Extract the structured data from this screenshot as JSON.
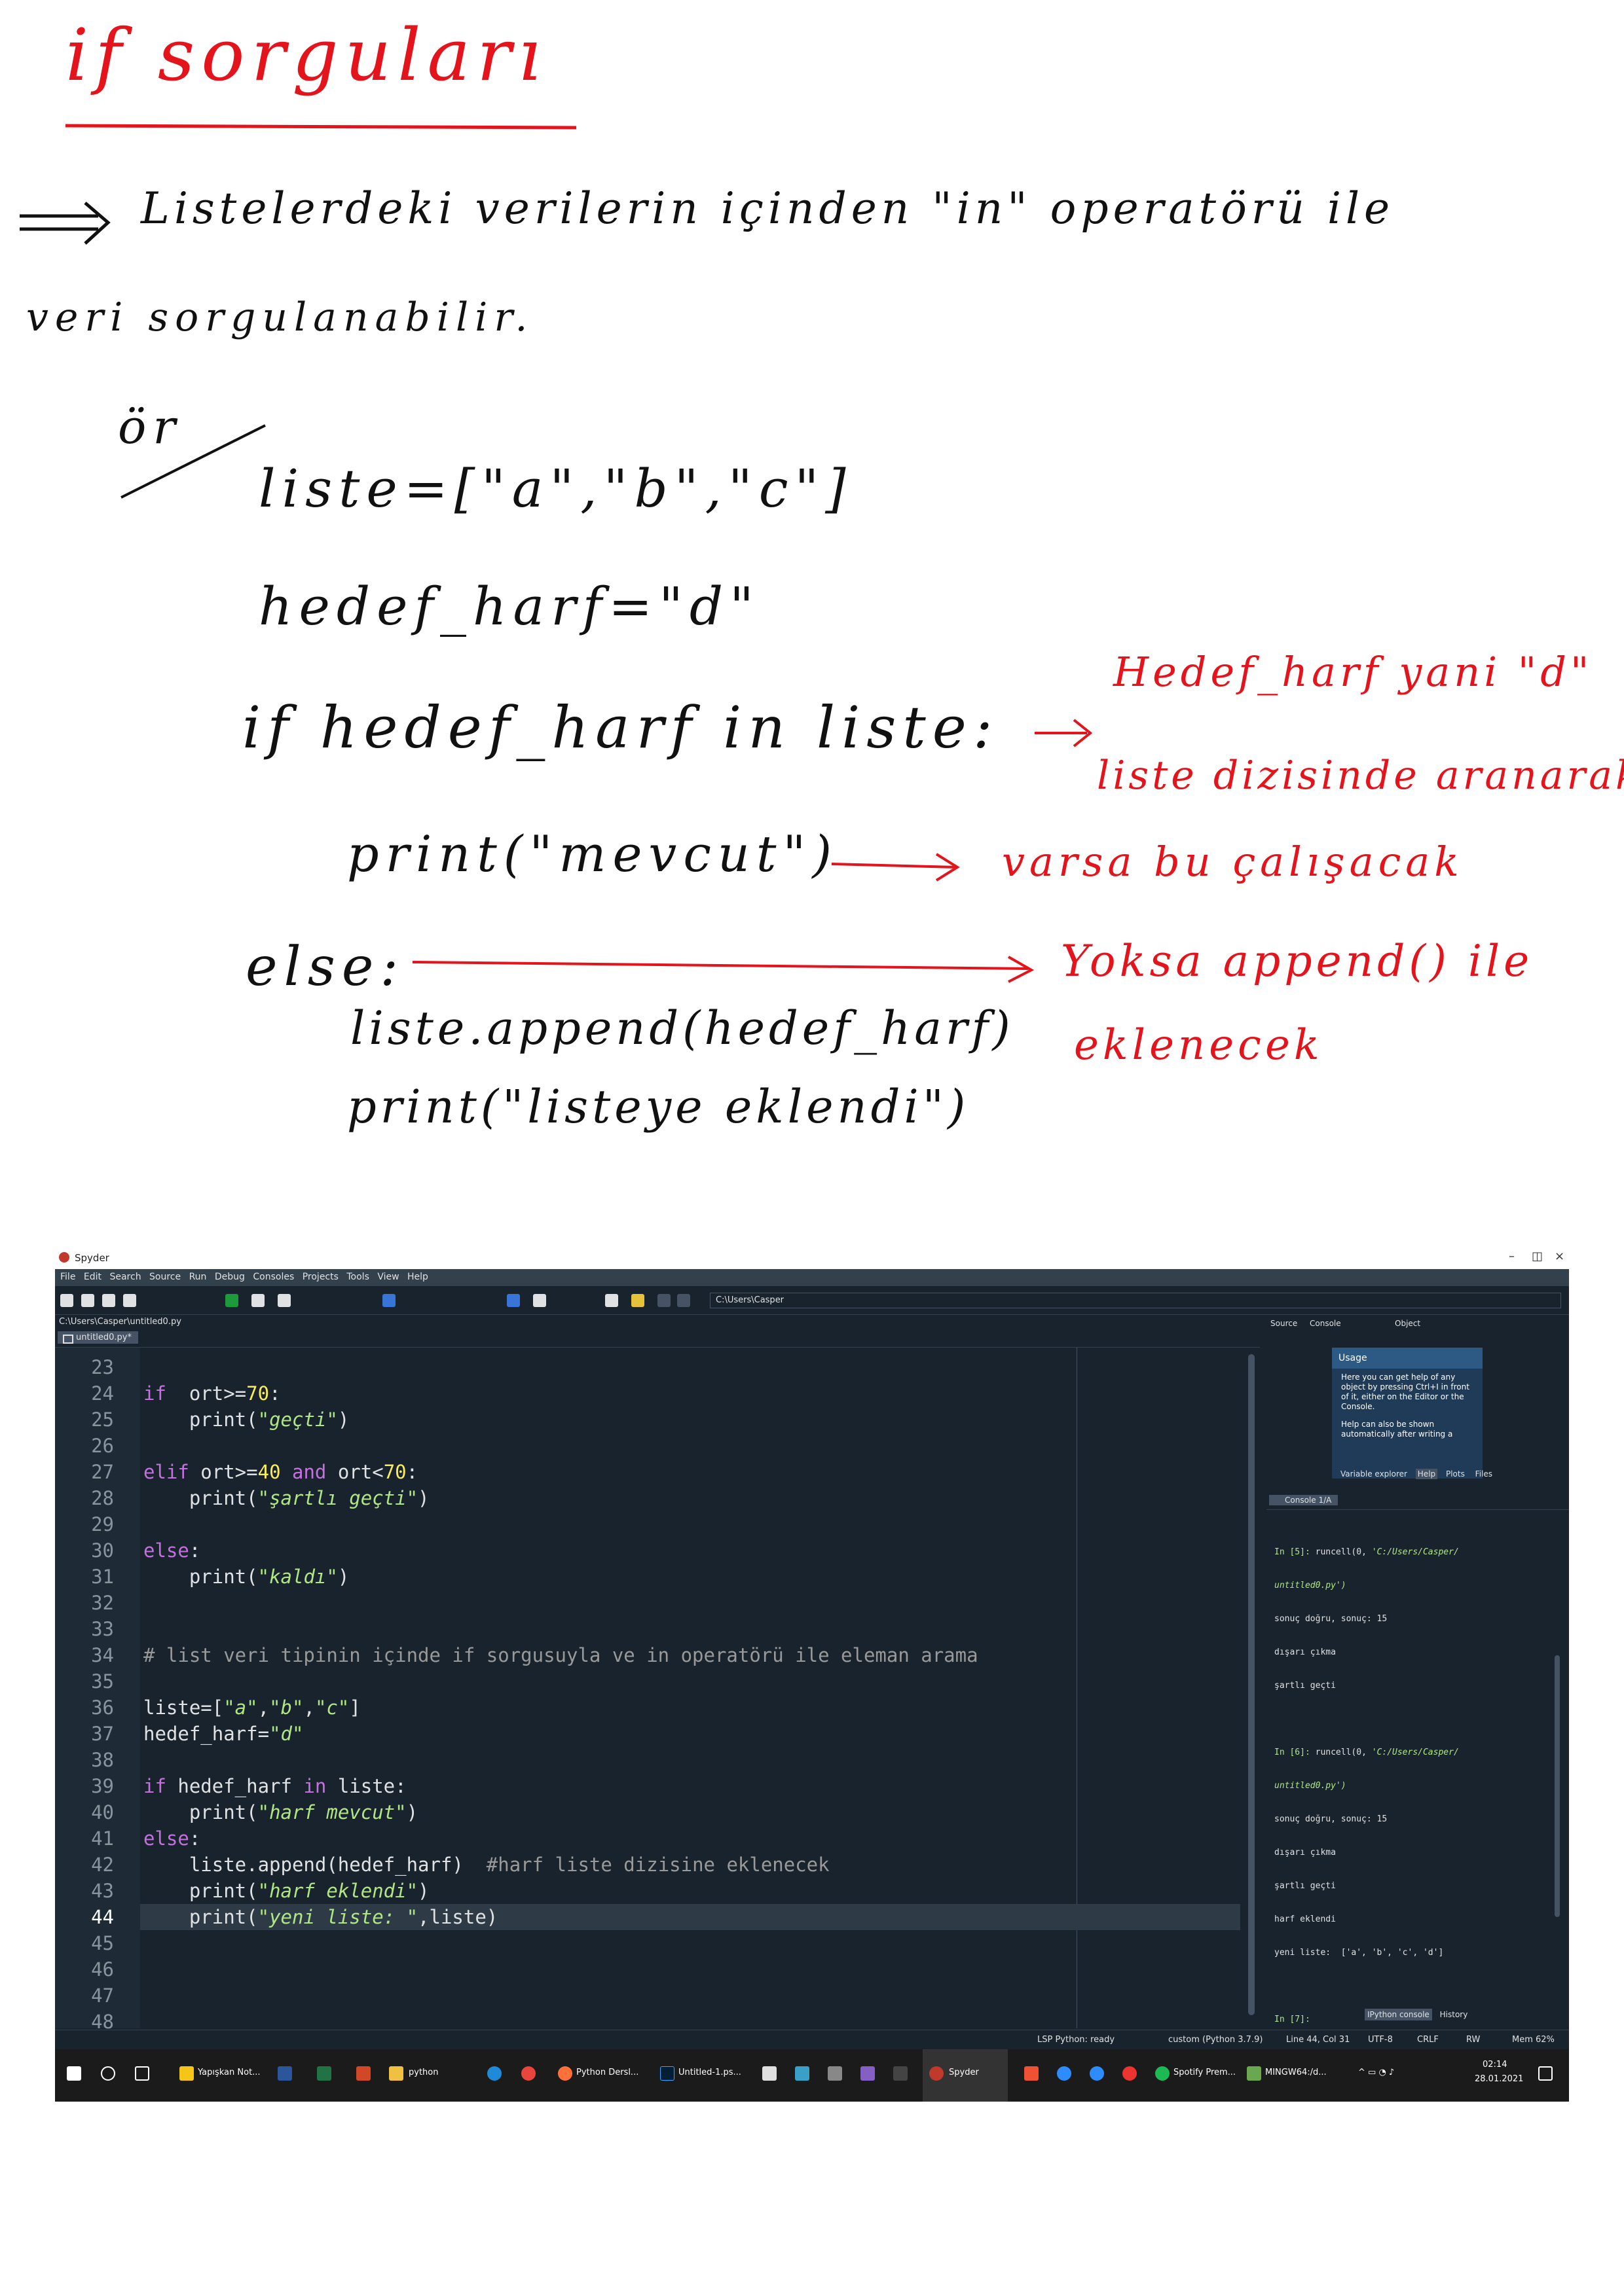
{
  "notes": {
    "title": "if sorguları",
    "intro_line1": "Listelerdeki verilerin içinden \"in\" operatörü ile",
    "intro_line2": "veri sorgulanabilir.",
    "example_label": "ör",
    "code": [
      "liste=[\"a\",\"b\",\"c\"]",
      "hedef_harf=\"d\"",
      "if hedef_harf in liste:",
      "print(\"mevcut\")",
      "else:",
      "liste.append(hedef_harf)",
      "print(\"listeye eklendi\")"
    ],
    "annotations": [
      "Hedef_harf yani \"d\"",
      "liste dizisinde aranarak",
      "varsa bu çalışacak",
      "Yoksa append() ile",
      "eklenecek"
    ]
  },
  "spyder": {
    "window_title": "Spyder",
    "menu": [
      "File",
      "Edit",
      "Search",
      "Source",
      "Run",
      "Debug",
      "Consoles",
      "Projects",
      "Tools",
      "View",
      "Help"
    ],
    "working_dir": "C:\\Users\\Casper",
    "file_path": "C:\\Users\\Casper\\untitled0.py",
    "tab_label": "untitled0.py*",
    "help": {
      "source_label": "Source",
      "source_value": "Console",
      "object_label": "Object",
      "usage_title": "Usage",
      "usage_p1": "Here you can get help of any object by pressing Ctrl+I in front of it, either on the Editor or the Console.",
      "usage_p2": "Help can also be shown automatically after writing a",
      "tabs": [
        "Variable explorer",
        "Help",
        "Plots",
        "Files"
      ]
    },
    "console_tab": "Console 1/A",
    "console_lines": [
      "In [5]: runcell(0, 'C:/Users/Casper/",
      "untitled0.py')",
      "sonuç doğru, sonuç: 15",
      "dışarı çıkma",
      "şartlı geçti",
      "",
      "In [6]: runcell(0, 'C:/Users/Casper/",
      "untitled0.py')",
      "sonuç doğru, sonuç: 15",
      "dışarı çıkma",
      "şartlı geçti",
      "harf eklendi",
      "yeni liste:  ['a', 'b', 'c', 'd']",
      "",
      "In [7]:"
    ],
    "console_bottom_tabs": [
      "IPython console",
      "History"
    ],
    "status": {
      "lsp": "LSP Python: ready",
      "env": "custom (Python 3.7.9)",
      "position": "Line 44, Col 31",
      "encoding": "UTF-8",
      "eol": "CRLF",
      "mode": "RW",
      "mem": "Mem 62%"
    },
    "taskbar": {
      "items": [
        "Yapışkan Not...",
        "python",
        "Python Dersl...",
        "Untitled-1.ps...",
        "Spyder",
        "Spotify Prem...",
        "MINGW64:/d..."
      ],
      "time": "02:14",
      "date": "28.01.2021"
    }
  }
}
